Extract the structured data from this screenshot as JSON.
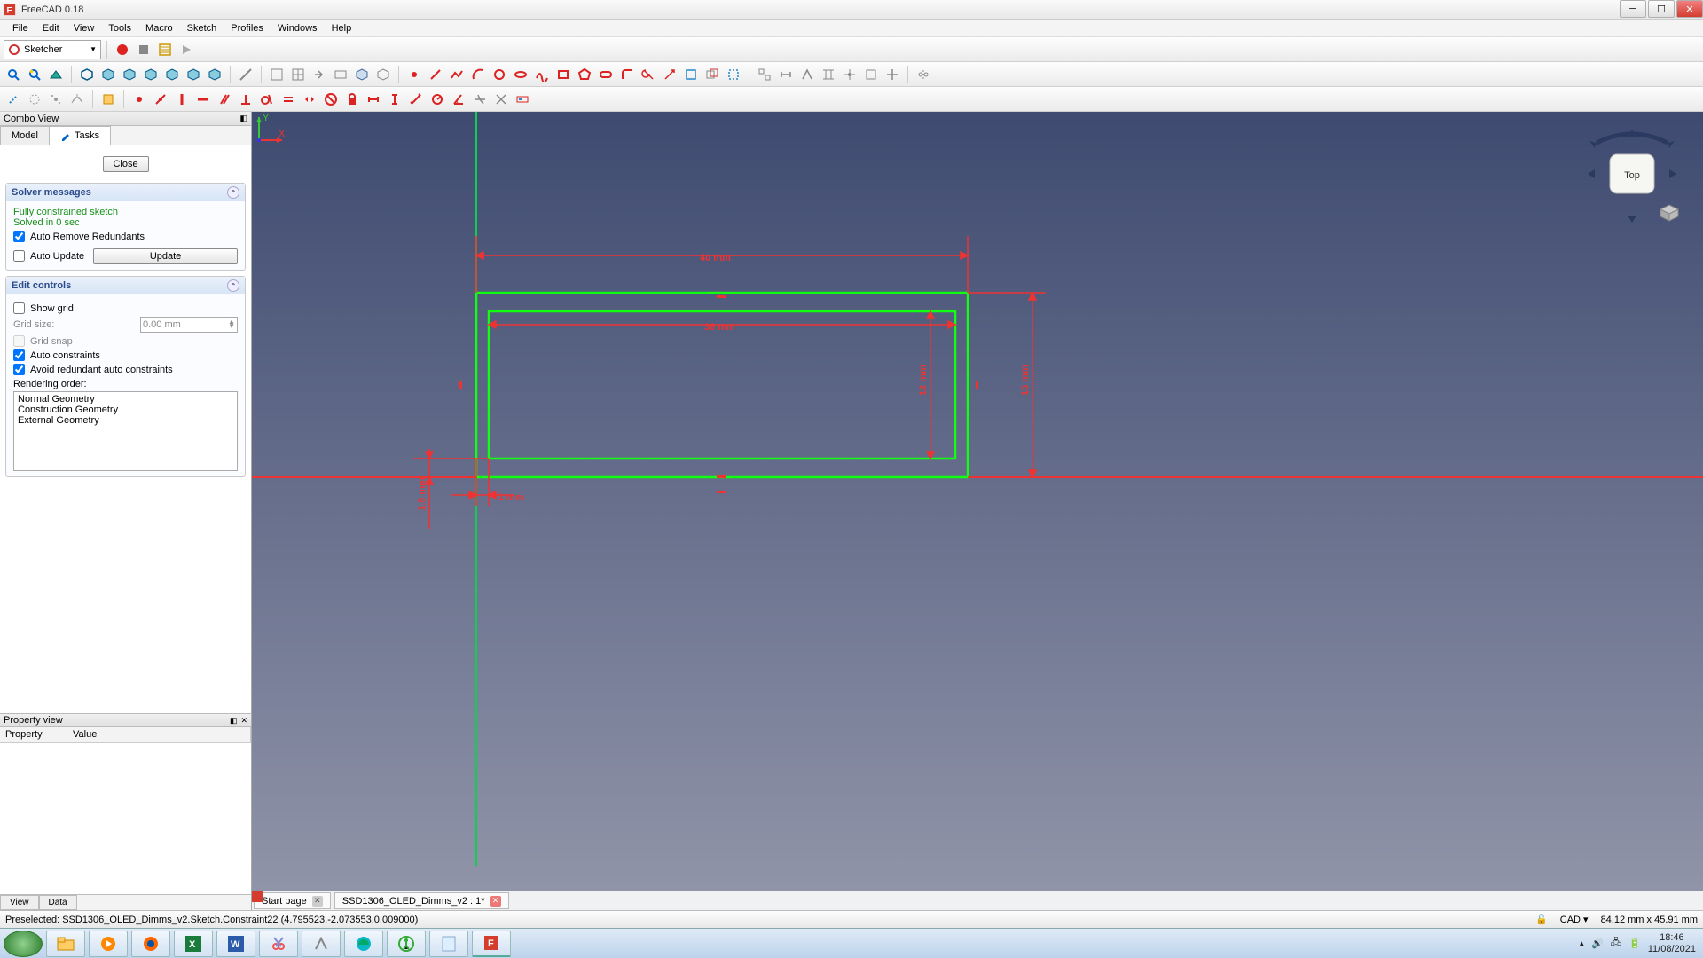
{
  "window": {
    "title": "FreeCAD 0.18"
  },
  "menu": [
    "File",
    "Edit",
    "View",
    "Tools",
    "Macro",
    "Sketch",
    "Profiles",
    "Windows",
    "Help"
  ],
  "workbench": {
    "selected": "Sketcher"
  },
  "combo": {
    "title": "Combo View",
    "tabs": {
      "model": "Model",
      "tasks": "Tasks"
    },
    "close_btn": "Close",
    "solver": {
      "title": "Solver messages",
      "line1": "Fully constrained sketch",
      "line2": "Solved in 0 sec",
      "auto_remove": "Auto Remove Redundants",
      "auto_update": "Auto Update",
      "update_btn": "Update"
    },
    "edit": {
      "title": "Edit controls",
      "show_grid": "Show grid",
      "grid_size_label": "Grid size:",
      "grid_size_value": "0.00 mm",
      "grid_snap": "Grid snap",
      "auto_constraints": "Auto constraints",
      "avoid_redundant": "Avoid redundant auto constraints",
      "render_label": "Rendering order:",
      "render_items": [
        "Normal Geometry",
        "Construction Geometry",
        "External Geometry"
      ]
    }
  },
  "property": {
    "title": "Property view",
    "col1": "Property",
    "col2": "Value",
    "tab_view": "View",
    "tab_data": "Data"
  },
  "viewport": {
    "navcube_face": "Top",
    "axis_y": "Y",
    "axis_x": "X",
    "dims": {
      "outer_w": "40 mm",
      "inner_w": "38 mm",
      "outer_h": "15 mm",
      "inner_h": "12 mm",
      "offset_h": "1.5 mm",
      "offset_w": "1 mm"
    }
  },
  "doctabs": {
    "start": "Start page",
    "doc": "SSD1306_OLED_Dimms_v2 : 1*"
  },
  "status": {
    "left": "Preselected: SSD1306_OLED_Dimms_v2.Sketch.Constraint22 (4.795523,-2.073553,0.009000)",
    "nav": "CAD",
    "dims": "84.12 mm x 45.91 mm"
  },
  "tray": {
    "time": "18:46",
    "date": "11/08/2021"
  }
}
